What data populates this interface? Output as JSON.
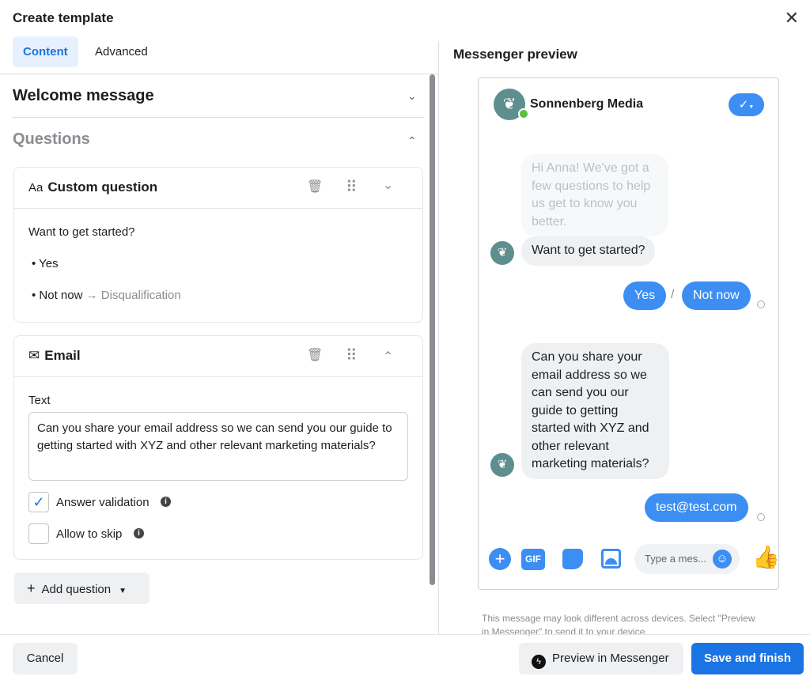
{
  "dialog": {
    "title": "Create template",
    "close": "✕"
  },
  "tabs": [
    {
      "label": "Content",
      "active": true
    },
    {
      "label": "Advanced",
      "active": false
    }
  ],
  "sections": {
    "welcome": "Welcome message",
    "questions": "Questions"
  },
  "custom_question": {
    "icon": "Aa",
    "title": "Custom question",
    "question": "Want to get started?",
    "options": [
      {
        "label": "Yes"
      },
      {
        "label": "Not now",
        "arrow": "→",
        "target": "Disqualification"
      }
    ]
  },
  "email": {
    "title": "Email",
    "text_label": "Text",
    "text": "Can you share your email address so we can send you our guide to getting started with XYZ and other relevant marketing materials?",
    "answer_validation": {
      "label": "Answer validation",
      "checked": true
    },
    "allow_skip": {
      "label": "Allow to skip",
      "checked": false
    }
  },
  "add_question": "Add question",
  "preview": {
    "title": "Messenger preview",
    "page_name": "Sonnenberg Media",
    "greeting": "Hi Anna! We've got a few questions to help us get to know you better.",
    "question1": "Want to get started?",
    "reply_yes": "Yes",
    "reply_sep": "/",
    "reply_no": "Not now",
    "question2": "Can you share your email address so we can send you our guide to getting started with XYZ and other relevant marketing materials?",
    "email_reply": "test@test.com",
    "gif": "GIF",
    "composer_placeholder": "Type a mes...",
    "disclaimer": "This message may look different across devices. Select \"Preview in Messenger\" to send it to your device."
  },
  "footer": {
    "cancel": "Cancel",
    "preview": "Preview in Messenger",
    "save": "Save and finish"
  },
  "colors": {
    "accent": "#1b74e4",
    "bubble_blue": "#3c8ef3",
    "online": "#5ac03e"
  }
}
